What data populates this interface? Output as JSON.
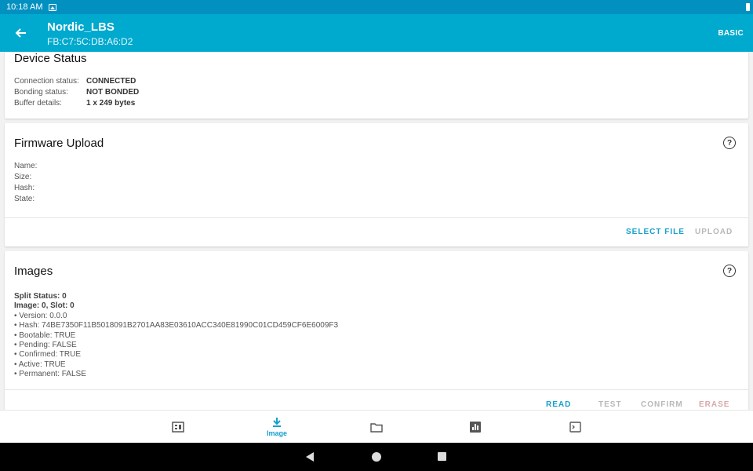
{
  "status_bar": {
    "time": "10:18 AM"
  },
  "app_bar": {
    "title": "Nordic_LBS",
    "subtitle": "FB:C7:5C:DB:A6:D2",
    "mode_button": "BASIC"
  },
  "device_status": {
    "title": "Device Status",
    "rows": [
      {
        "label": "Connection status:",
        "value": "CONNECTED"
      },
      {
        "label": "Bonding status:",
        "value": "NOT BONDED"
      },
      {
        "label": "Buffer details:",
        "value": "1 x 249 bytes"
      }
    ]
  },
  "firmware_upload": {
    "title": "Firmware Upload",
    "fields": [
      "Name:",
      "Size:",
      "Hash:",
      "State:"
    ],
    "select_file": "SELECT FILE",
    "upload": "UPLOAD"
  },
  "images": {
    "title": "Images",
    "split_status": "Split Status: 0",
    "image_slot": "Image: 0, Slot: 0",
    "details": [
      "• Version: 0.0.0",
      "• Hash: 74BE7350F11B5018091B2701AA83E03610ACC340E81990C01CD459CF6E6009F3",
      "• Bootable: TRUE",
      "• Pending: FALSE",
      "• Confirmed: TRUE",
      "• Active: TRUE",
      "• Permanent: FALSE"
    ],
    "read": "READ",
    "test": "TEST",
    "confirm": "CONFIRM",
    "erase": "ERASE"
  },
  "bottom_nav": {
    "image_label": "Image"
  },
  "colors": {
    "app_bar": "#00a9ce",
    "status_bar": "#0290c0",
    "accent": "#16a0cc"
  }
}
